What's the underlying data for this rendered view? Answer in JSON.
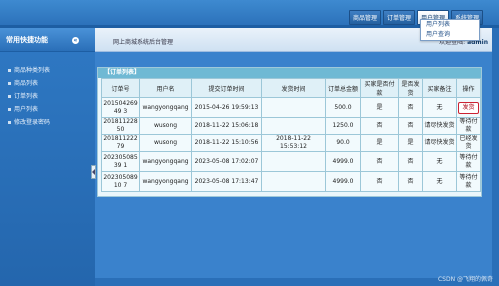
{
  "header": {
    "nav": [
      "商品管理",
      "订单管理",
      "用户管理",
      "系统管理"
    ],
    "active_index": 2,
    "dropdown": [
      "用户列表",
      "用户查询"
    ]
  },
  "sidebar": {
    "title": "常用快捷功能",
    "items": [
      "商品种类列表",
      "商品列表",
      "订单列表",
      "用户列表",
      "修改登录密码"
    ]
  },
  "crumb": {
    "title": "网上商城系统后台管理",
    "welcome_prefix": "欢迎登陆:",
    "user": "admin"
  },
  "panel": {
    "title": "【订单列表】",
    "columns": [
      "订单号",
      "用户名",
      "提交订单时间",
      "发货时间",
      "订单总金额",
      "买家是否付款",
      "是否发货",
      "买家备注",
      "操作"
    ],
    "rows": [
      {
        "id": "20150426949 3",
        "user": "wangyongqang",
        "submit": "2015-04-26 19:59:13",
        "ship": "",
        "amount": "500.0",
        "paid": "是",
        "shipped": "否",
        "remark": "无",
        "action": "发货",
        "action_type": "button"
      },
      {
        "id": "20181122850",
        "user": "wusong",
        "submit": "2018-11-22 15:06:18",
        "ship": "",
        "amount": "1250.0",
        "paid": "否",
        "shipped": "否",
        "remark": "请尽快发货",
        "action": "等待付款",
        "action_type": "text"
      },
      {
        "id": "20181122279",
        "user": "wusong",
        "submit": "2018-11-22 15:10:56",
        "ship": "2018-11-22 15:53:12",
        "amount": "90.0",
        "paid": "是",
        "shipped": "是",
        "remark": "请尽快发货",
        "action": "已经发货",
        "action_type": "text"
      },
      {
        "id": "20230508539 1",
        "user": "wangyongqang",
        "submit": "2023-05-08 17:02:07",
        "ship": "",
        "amount": "4999.0",
        "paid": "否",
        "shipped": "否",
        "remark": "无",
        "action": "等待付款",
        "action_type": "text"
      },
      {
        "id": "20230508910 7",
        "user": "wangyongqang",
        "submit": "2023-05-08 17:13:47",
        "ship": "",
        "amount": "4999.0",
        "paid": "否",
        "shipped": "否",
        "remark": "无",
        "action": "等待付款",
        "action_type": "text"
      }
    ]
  },
  "credit": "CSDN @飞翔的佩奇"
}
